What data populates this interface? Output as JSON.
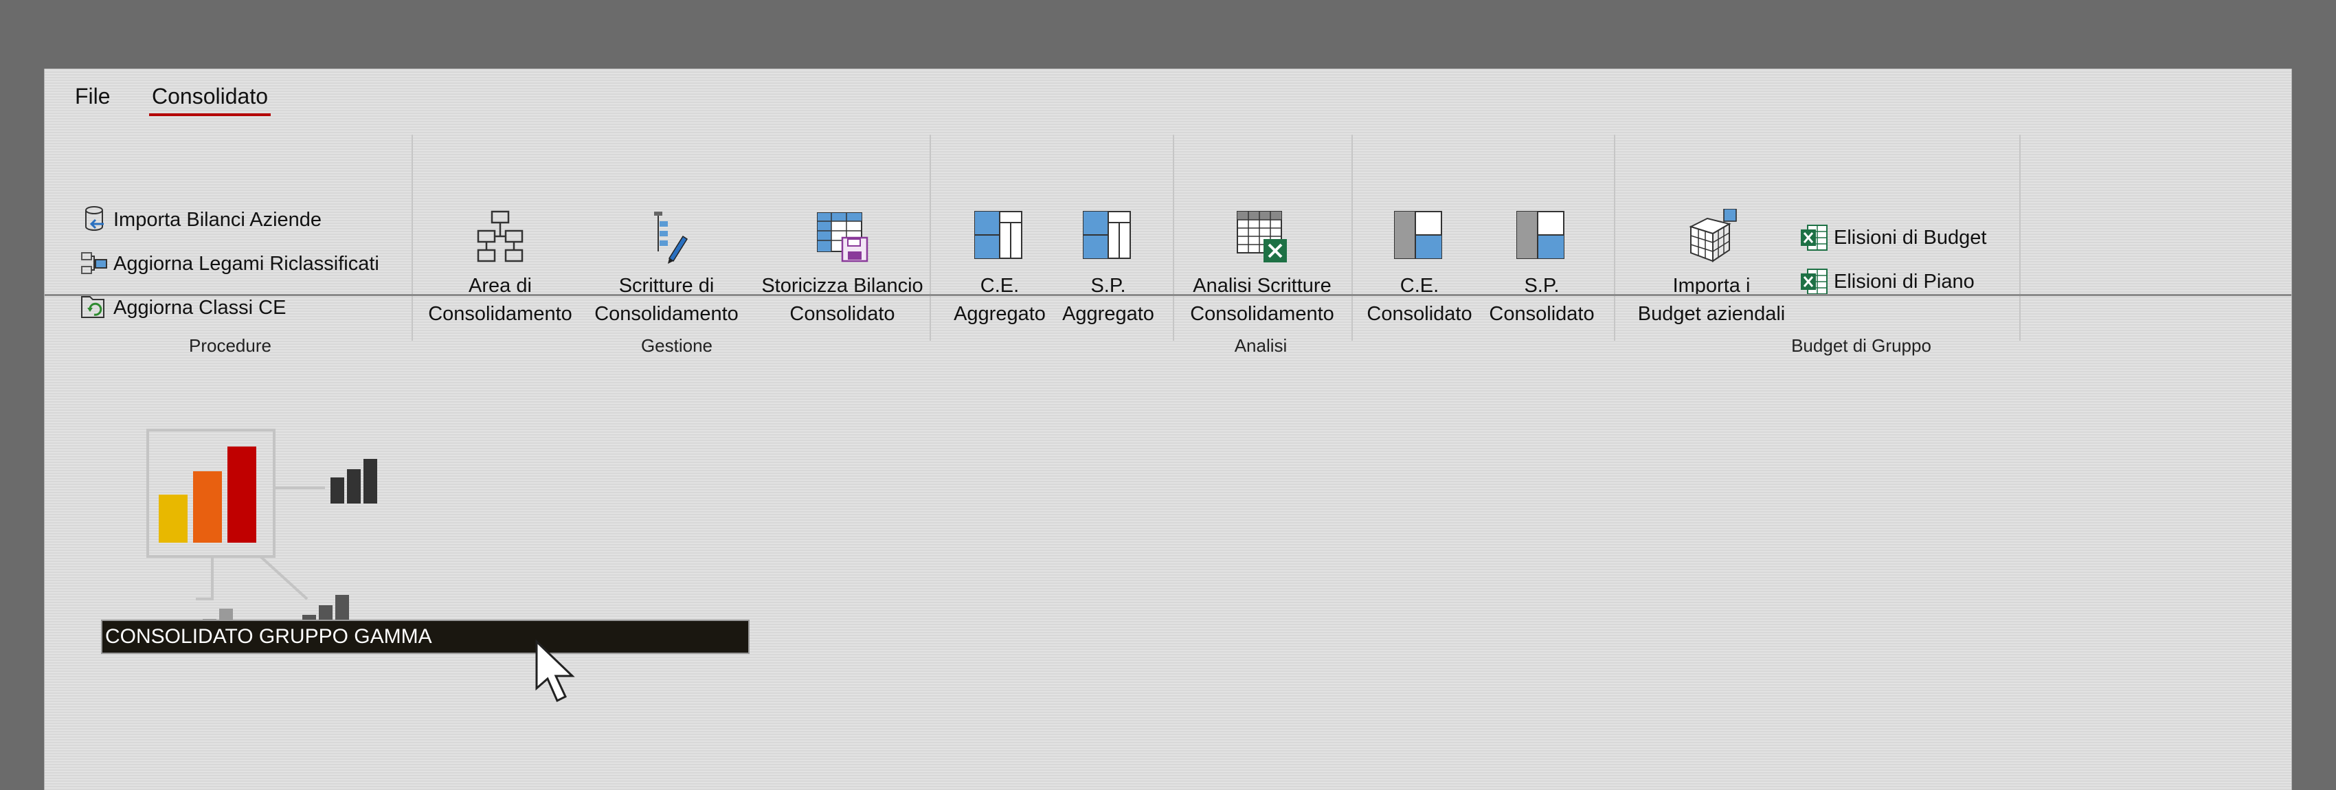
{
  "tabs": [
    {
      "label": "File",
      "active": false
    },
    {
      "label": "Consolidato",
      "active": true
    }
  ],
  "ribbon": {
    "procedure": {
      "label": "Procedure",
      "items": [
        {
          "label": "Importa Bilanci Aziende",
          "icon": "import-database-icon"
        },
        {
          "label": "Aggiorna Legami Riclassificati",
          "icon": "update-links-icon"
        },
        {
          "label": "Aggiorna Classi CE",
          "icon": "refresh-classes-icon"
        }
      ]
    },
    "gestione": {
      "label": "Gestione",
      "items": [
        {
          "line1": "Area di",
          "line2": "Consolidamento",
          "icon": "org-chart-icon"
        },
        {
          "line1": "Scritture di",
          "line2": "Consolidamento",
          "icon": "journal-edit-icon"
        },
        {
          "line1": "Storicizza Bilancio",
          "line2": "Consolidato",
          "icon": "save-table-icon"
        }
      ]
    },
    "analisi": {
      "label": "Analisi",
      "items": [
        {
          "line1": "C.E.",
          "line2": "Aggregato",
          "icon": "aggregated-ce-icon"
        },
        {
          "line1": "S.P.",
          "line2": "Aggregato",
          "icon": "aggregated-sp-icon"
        },
        {
          "line1": "Analisi Scritture",
          "line2": "Consolidamento",
          "icon": "excel-table-icon"
        },
        {
          "line1": "C.E.",
          "line2": "Consolidato",
          "icon": "consolidated-ce-icon"
        },
        {
          "line1": "S.P.",
          "line2": "Consolidato",
          "icon": "consolidated-sp-icon"
        }
      ]
    },
    "budget": {
      "label": "Budget di Gruppo",
      "import": {
        "line1": "Importa i",
        "line2": "Budget aziendali",
        "icon": "cube-import-icon"
      },
      "items": [
        {
          "label": "Elisioni di Budget",
          "icon": "excel-icon"
        },
        {
          "label": "Elisioni di Piano",
          "icon": "excel-icon"
        }
      ]
    }
  },
  "company": {
    "name": "CONSOLIDATO GRUPPO GAMMA"
  },
  "colors": {
    "accent": "#b40000",
    "bar_yellow": "#e8b800",
    "bar_orange": "#e86010",
    "bar_red": "#c00000",
    "icon_blue": "#5b9bd5",
    "excel_green": "#1e7145"
  }
}
